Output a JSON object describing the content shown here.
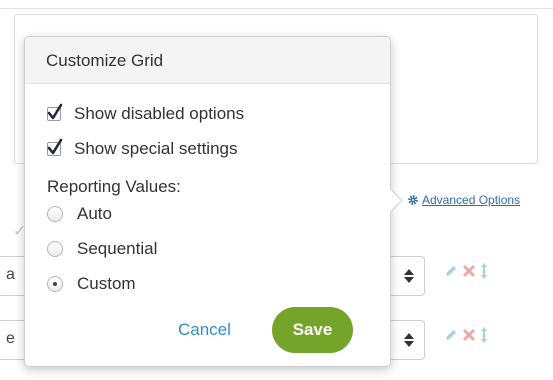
{
  "background": {
    "advanced_options_label": "Advanced Options",
    "row1_fragment": "a",
    "row2_fragment": "e"
  },
  "popover": {
    "title": "Customize Grid",
    "checkboxes": [
      {
        "label": "Show disabled options",
        "checked": true
      },
      {
        "label": "Show special settings",
        "checked": true
      }
    ],
    "reporting_label": "Reporting Values:",
    "radios": [
      {
        "label": "Auto",
        "selected": false
      },
      {
        "label": "Sequential",
        "selected": false
      },
      {
        "label": "Custom",
        "selected": true
      }
    ],
    "cancel_label": "Cancel",
    "save_label": "Save"
  },
  "colors": {
    "accent_green": "#74a52a",
    "link_blue": "#2f8fc9",
    "delete_red": "#f2a5a5",
    "icon_blue": "#a9cfe8"
  },
  "icons": [
    "gear-icon",
    "pencil-icon",
    "delete-x-icon",
    "move-arrows-icon",
    "checkmark-icon"
  ]
}
